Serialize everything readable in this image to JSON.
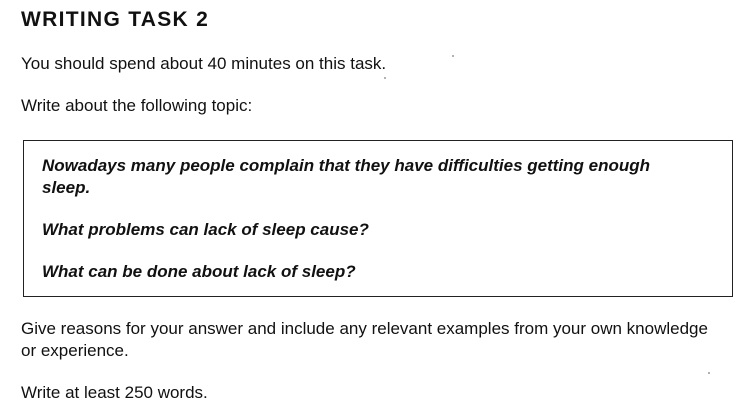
{
  "heading": "WRITING TASK 2",
  "instructions": {
    "time": "You should spend about 40 minutes on this task.",
    "topic_intro": "Write about the following topic:"
  },
  "task_box": {
    "statement": "Nowadays many people complain that they have difficulties getting enough sleep.",
    "question_1": "What problems can lack of sleep cause?",
    "question_2": "What can be done about lack of sleep?"
  },
  "closing": {
    "reasons": "Give reasons for your answer and include any relevant examples from your own knowledge or experience.",
    "word_count": "Write at least 250 words."
  }
}
